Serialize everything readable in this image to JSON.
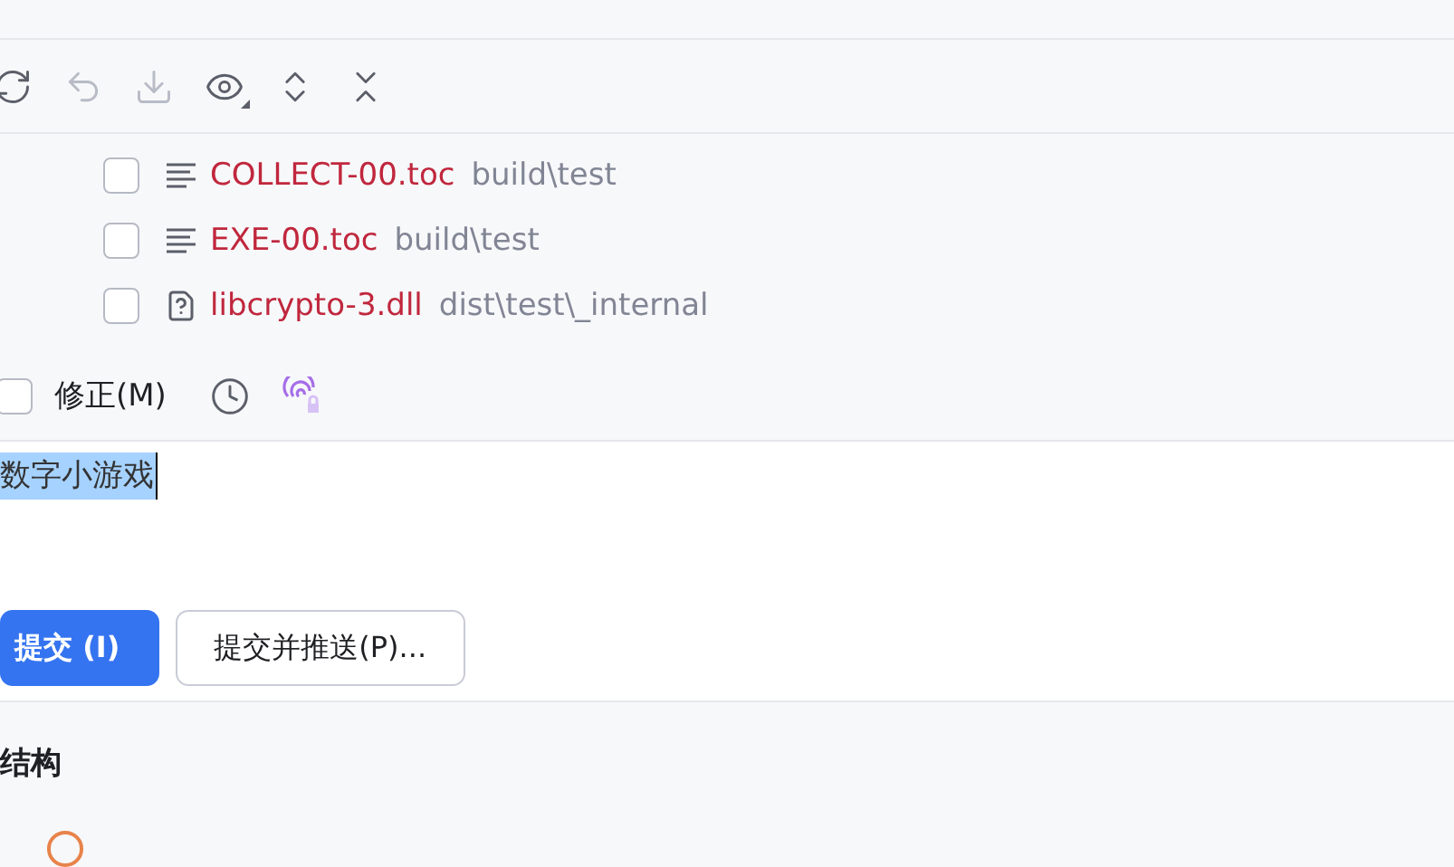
{
  "toolbar": [
    {
      "kind": "refresh",
      "disabled": false
    },
    {
      "kind": "undo",
      "disabled": true
    },
    {
      "kind": "download",
      "disabled": true
    },
    {
      "kind": "view",
      "disabled": false
    },
    {
      "kind": "expand",
      "disabled": false
    },
    {
      "kind": "collapse",
      "disabled": false
    }
  ],
  "files": [
    {
      "name": "COLLECT-00.toc",
      "path": "build\\test",
      "kind": "text",
      "checked": false
    },
    {
      "name": "EXE-00.toc",
      "path": "build\\test",
      "kind": "text",
      "checked": false
    },
    {
      "name": "libcrypto-3.dll",
      "path": "dist\\test\\_internal",
      "kind": "unknown",
      "checked": false
    }
  ],
  "amend": {
    "label": "修正(M)",
    "checked": false
  },
  "message": {
    "value": "数字小游戏",
    "selected": true
  },
  "buttons": [
    {
      "label": "提交 (I)",
      "kind": "primary"
    },
    {
      "label": "提交并推送(P)...",
      "kind": "secondary"
    }
  ],
  "section": {
    "title": "结构"
  }
}
